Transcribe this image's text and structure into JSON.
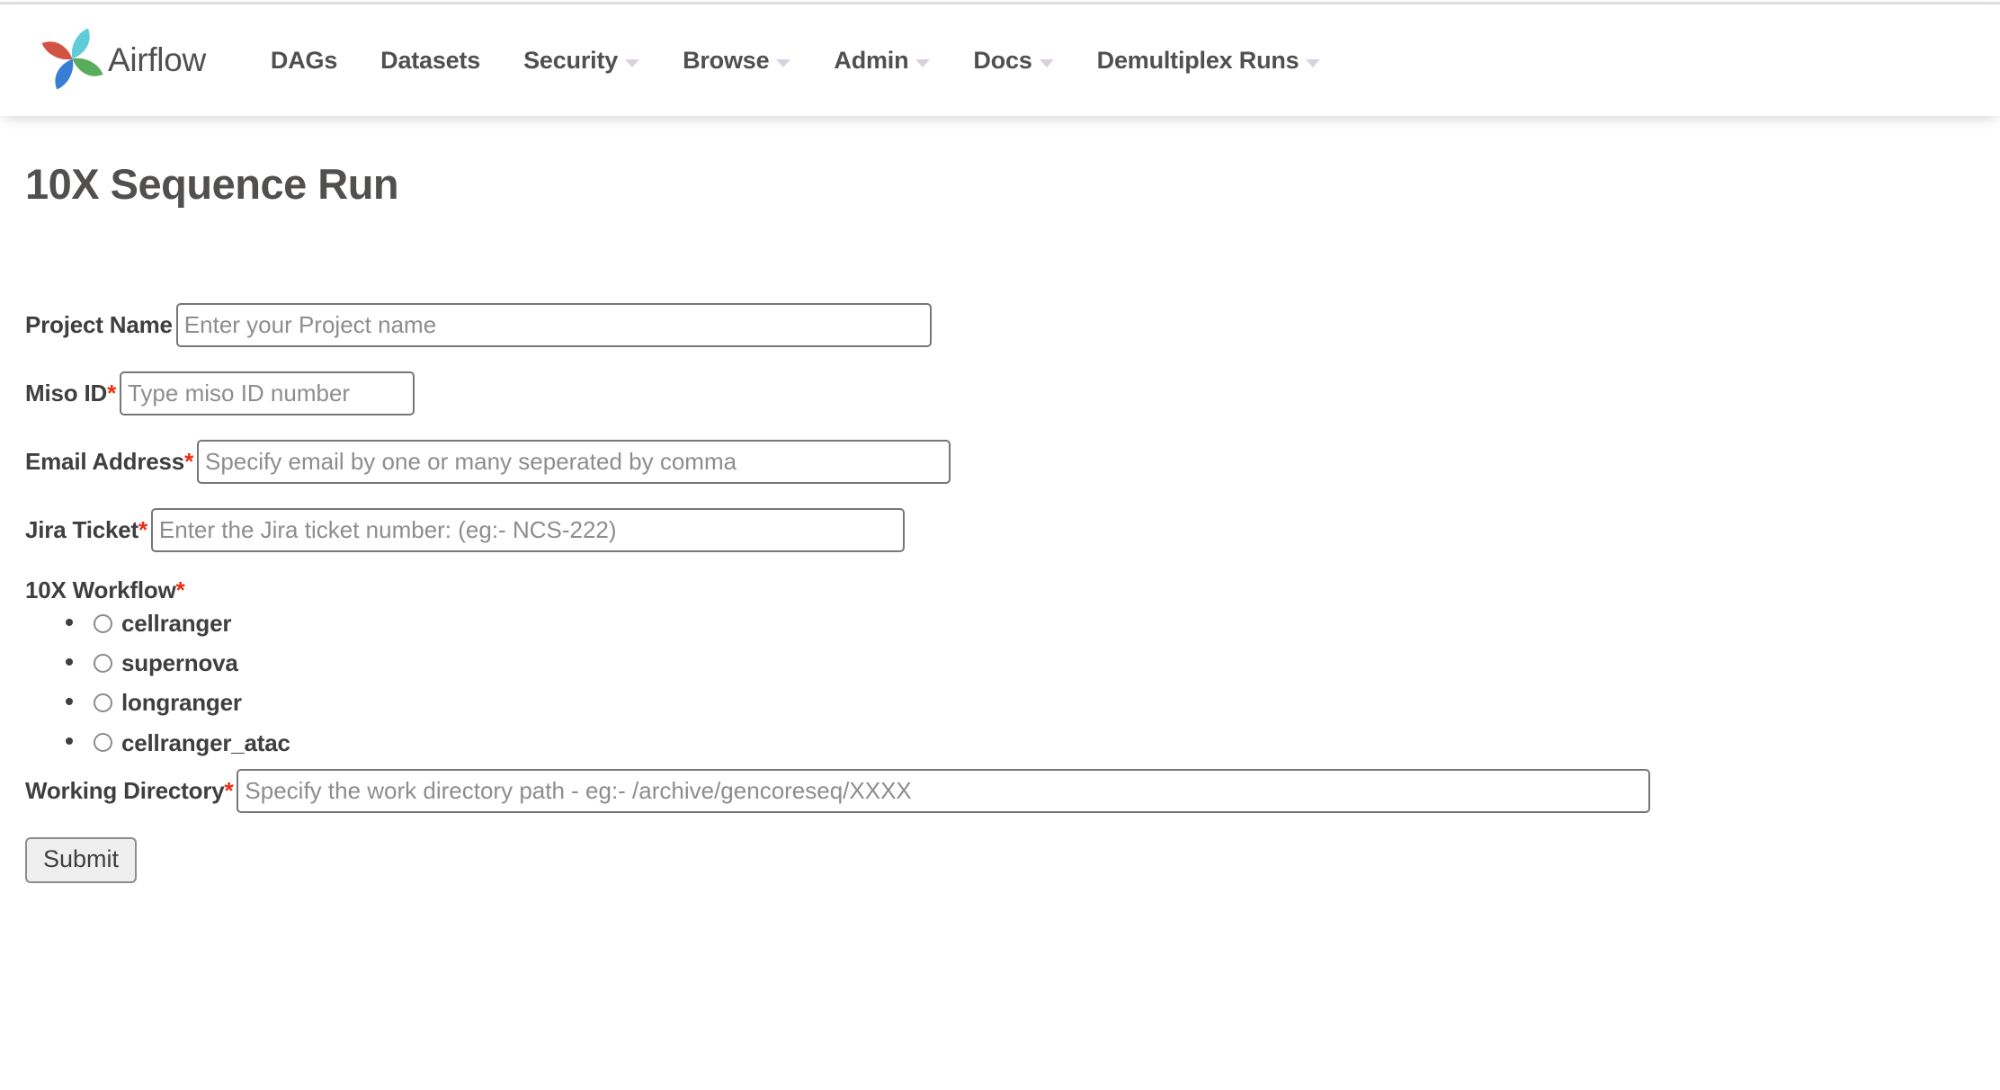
{
  "navbar": {
    "brand_name": "Airflow",
    "logo_icon": "airflow-pinwheel-icon",
    "items": [
      {
        "label": "DAGs",
        "has_caret": false
      },
      {
        "label": "Datasets",
        "has_caret": false
      },
      {
        "label": "Security",
        "has_caret": true
      },
      {
        "label": "Browse",
        "has_caret": true
      },
      {
        "label": "Admin",
        "has_caret": true
      },
      {
        "label": "Docs",
        "has_caret": true
      },
      {
        "label": "Demultiplex Runs",
        "has_caret": true
      }
    ]
  },
  "page": {
    "title": "10X Sequence Run"
  },
  "form": {
    "project_name": {
      "label": "Project Name",
      "required_mark": "",
      "value": "",
      "placeholder": "Enter your Project name"
    },
    "miso_id": {
      "label": "Miso ID",
      "required_mark": "*",
      "value": "",
      "placeholder": "Type miso ID number"
    },
    "email_address": {
      "label": "Email Address",
      "required_mark": "*",
      "value": "",
      "placeholder": "Specify email by one or many seperated by comma"
    },
    "jira_ticket": {
      "label": "Jira Ticket",
      "required_mark": "*",
      "value": "",
      "placeholder": "Enter the Jira ticket number: (eg:- NCS-222)"
    },
    "workflow": {
      "label": "10X Workflow",
      "required_mark": "*",
      "selected": "",
      "options": [
        {
          "label": "cellranger",
          "checked": false
        },
        {
          "label": "supernova",
          "checked": false
        },
        {
          "label": "longranger",
          "checked": false
        },
        {
          "label": "cellranger_atac",
          "checked": false
        }
      ]
    },
    "working_directory": {
      "label": "Working Directory",
      "required_mark": "*",
      "value": "",
      "placeholder": "Specify the work directory path - eg:- /archive/gencoreseq/XXXX"
    },
    "submit_label": "Submit"
  },
  "colors": {
    "required_asterisk": "#ef2b0f",
    "text": "#51504f",
    "label": "#3f3f3f",
    "input_border": "#767676",
    "placeholder": "#8d8d8d",
    "caret": "#d9d2de",
    "logo_red": "#cf4434",
    "logo_cyan": "#51c9d6",
    "logo_blue": "#2a72d4",
    "logo_green": "#4ba64f"
  }
}
